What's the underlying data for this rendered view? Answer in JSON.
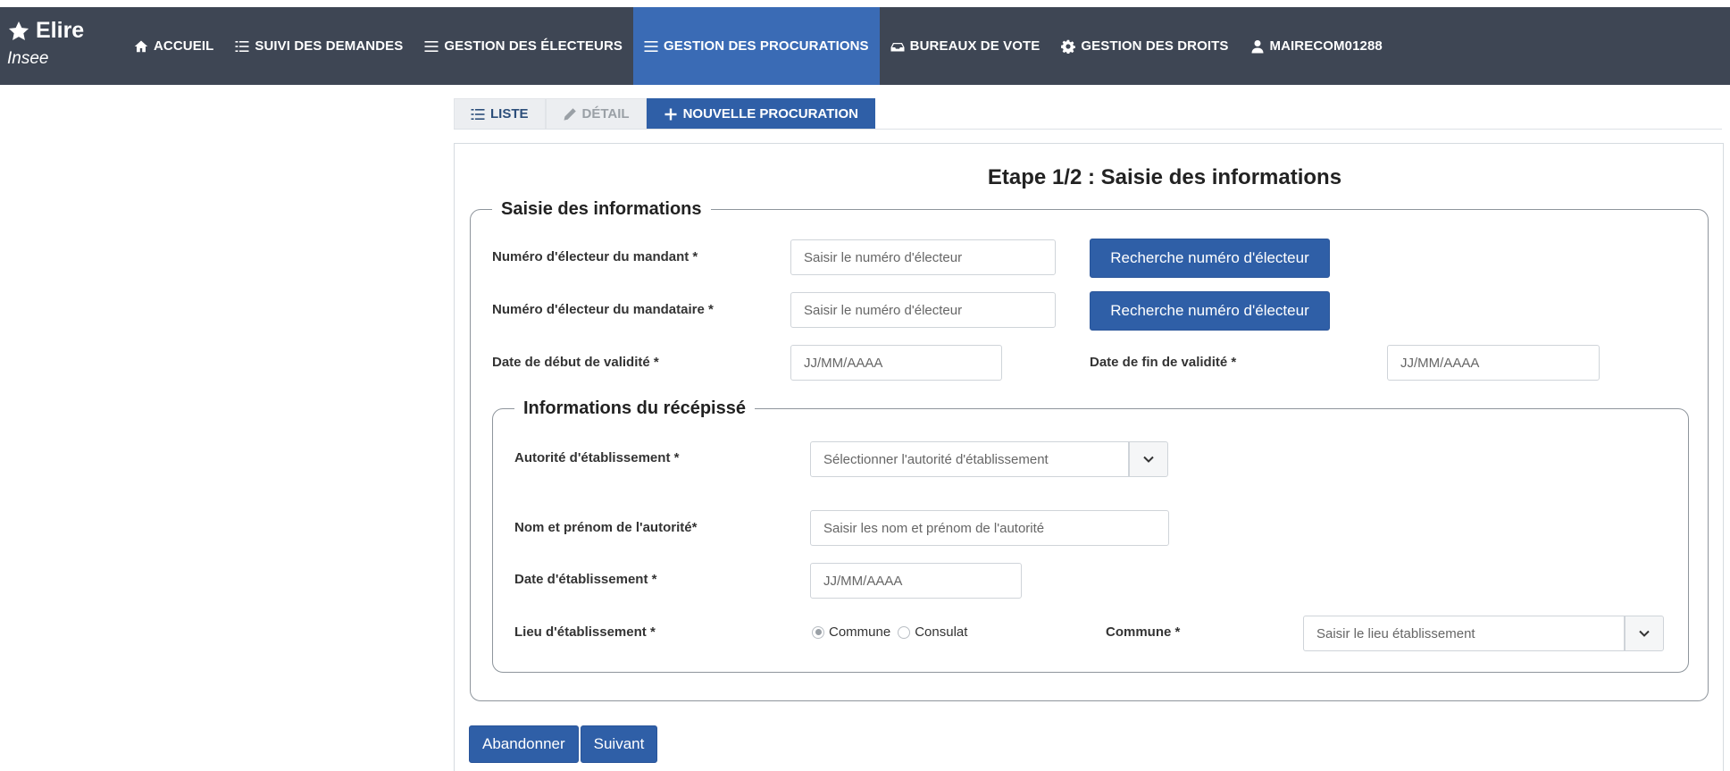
{
  "app": {
    "title": "Elire",
    "subtitle": "Insee"
  },
  "nav": [
    {
      "label": "ACCUEIL",
      "icon": "home-icon",
      "active": false
    },
    {
      "label": "SUIVI DES DEMANDES",
      "icon": "list-icon",
      "active": false
    },
    {
      "label": "GESTION DES ÉLECTEURS",
      "icon": "list-icon",
      "active": false
    },
    {
      "label": "GESTION DES PROCURATIONS",
      "icon": "list-icon",
      "active": true
    },
    {
      "label": "BUREAUX DE VOTE",
      "icon": "ballot-icon",
      "active": false
    },
    {
      "label": "GESTION DES DROITS",
      "icon": "gear-icon",
      "active": false
    },
    {
      "label": "MAIRECOM01288",
      "icon": "user-icon",
      "active": false
    }
  ],
  "tabs": [
    {
      "label": "LISTE",
      "icon": "list-icon",
      "state": "normal"
    },
    {
      "label": "DÉTAIL",
      "icon": "pencil-icon",
      "state": "disabled"
    },
    {
      "label": "NOUVELLE PROCURATION",
      "icon": "plus-icon",
      "state": "active"
    }
  ],
  "form": {
    "step_title": "Etape 1/2 : Saisie des informations",
    "section1_legend": "Saisie des informations",
    "mandant_label": "Numéro d'électeur du mandant *",
    "mandant_placeholder": "Saisir le numéro d'électeur",
    "mandataire_label": "Numéro d'électeur du mandataire *",
    "mandataire_placeholder": "Saisir le numéro d'électeur",
    "search_button": "Recherche numéro d'électeur",
    "date_debut_label": "Date de début de validité *",
    "date_fin_label": "Date de fin de validité *",
    "date_placeholder": "JJ/MM/AAAA",
    "section2_legend": "Informations du récépissé",
    "autorite_label": "Autorité d'établissement *",
    "autorite_placeholder": "Sélectionner l'autorité d'établissement",
    "nom_autorite_label": "Nom et prénom de l'autorité*",
    "nom_autorite_placeholder": "Saisir les nom et prénom de l'autorité",
    "date_etab_label": "Date d'établissement *",
    "lieu_label": "Lieu d'établissement *",
    "lieu_options": [
      "Commune",
      "Consulat"
    ],
    "lieu_selected": "Commune",
    "commune_label": "Commune *",
    "commune_placeholder": "Saisir le lieu établissement"
  },
  "actions": {
    "abandon": "Abandonner",
    "next": "Suivant"
  },
  "colors": {
    "navbar": "#3e4654",
    "accent": "#2f5fa7"
  }
}
